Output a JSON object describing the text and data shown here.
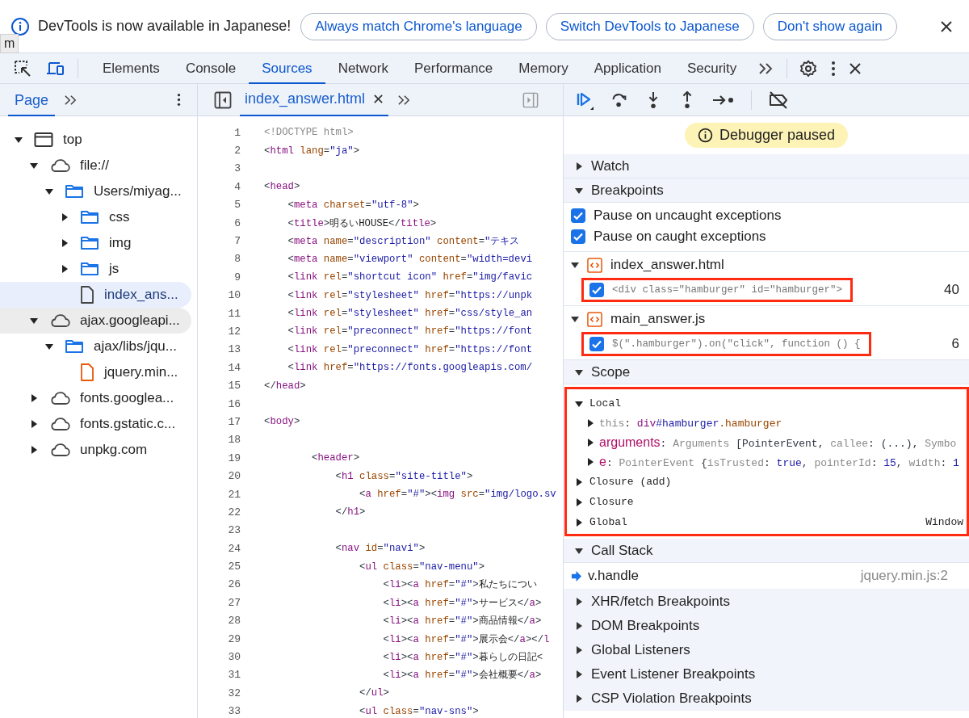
{
  "banner": {
    "message": "DevTools is now available in Japanese!",
    "buttons": [
      "Always match Chrome's language",
      "Switch DevTools to Japanese",
      "Don't show again"
    ]
  },
  "tooltip": "m",
  "tabs": [
    {
      "label": "Elements",
      "selected": false
    },
    {
      "label": "Console",
      "selected": false
    },
    {
      "label": "Sources",
      "selected": true
    },
    {
      "label": "Network",
      "selected": false
    },
    {
      "label": "Performance",
      "selected": false
    },
    {
      "label": "Memory",
      "selected": false
    },
    {
      "label": "Application",
      "selected": false
    },
    {
      "label": "Security",
      "selected": false
    }
  ],
  "navigator": {
    "tabs": [
      {
        "label": "Page",
        "selected": true
      }
    ],
    "tree": [
      {
        "label": "top",
        "kind": "frame",
        "expanded": true,
        "selected": false,
        "hovered": false,
        "children": [
          {
            "label": "file://",
            "kind": "domain",
            "expanded": true,
            "selected": false,
            "hovered": false,
            "children": [
              {
                "label": "Users/miyag...",
                "kind": "folder",
                "expanded": true,
                "selected": false,
                "hovered": false,
                "children": [
                  {
                    "label": "css",
                    "kind": "folder",
                    "expanded": false,
                    "selected": false,
                    "hovered": false
                  },
                  {
                    "label": "img",
                    "kind": "folder",
                    "expanded": false,
                    "selected": false,
                    "hovered": false
                  },
                  {
                    "label": "js",
                    "kind": "folder",
                    "expanded": false,
                    "selected": false,
                    "hovered": false
                  },
                  {
                    "label": "index_ans...",
                    "kind": "file",
                    "selected": true,
                    "hovered": false
                  }
                ]
              }
            ]
          },
          {
            "label": "ajax.googleapi...",
            "kind": "domain",
            "expanded": true,
            "selected": false,
            "hovered": true,
            "children": [
              {
                "label": "ajax/libs/jqu...",
                "kind": "folder",
                "expanded": true,
                "selected": false,
                "hovered": false,
                "children": [
                  {
                    "label": "jquery.min...",
                    "kind": "script",
                    "selected": false,
                    "hovered": false
                  }
                ]
              }
            ]
          },
          {
            "label": "fonts.googlea...",
            "kind": "domain",
            "expanded": false,
            "selected": false,
            "hovered": false
          },
          {
            "label": "fonts.gstatic.c...",
            "kind": "domain",
            "expanded": false,
            "selected": false,
            "hovered": false
          },
          {
            "label": "unpkg.com",
            "kind": "domain",
            "expanded": false,
            "selected": false,
            "hovered": false
          }
        ]
      }
    ]
  },
  "editor": {
    "tabs": [
      {
        "label": "index_answer.html",
        "selected": true
      }
    ],
    "lines": [
      {
        "n": "1",
        "code": [
          {
            "kind": "doc",
            "text": "<!DOCTYPE html>"
          }
        ]
      },
      {
        "n": "2",
        "code": [
          {
            "kind": "p",
            "text": "<"
          },
          {
            "kind": "tag",
            "text": "html"
          },
          {
            "kind": "attr",
            "text": " lang"
          },
          {
            "kind": "p",
            "text": "="
          },
          {
            "kind": "str",
            "text": "\"ja\""
          },
          {
            "kind": "p",
            "text": ">"
          }
        ]
      },
      {
        "n": "3"
      },
      {
        "n": "4",
        "code": [
          {
            "kind": "p",
            "text": "<"
          },
          {
            "kind": "tag",
            "text": "head"
          },
          {
            "kind": "p",
            "text": ">"
          }
        ]
      },
      {
        "n": "5",
        "code": [
          {
            "kind": "p",
            "text": "    <"
          },
          {
            "kind": "tag",
            "text": "meta"
          },
          {
            "kind": "attr",
            "text": " charset"
          },
          {
            "kind": "p",
            "text": "="
          },
          {
            "kind": "str",
            "text": "\"utf-8\""
          },
          {
            "kind": "p",
            "text": ">"
          }
        ]
      },
      {
        "n": "6",
        "code": [
          {
            "kind": "p",
            "text": "    <"
          },
          {
            "kind": "tag",
            "text": "title"
          },
          {
            "kind": "p",
            "text": ">"
          },
          {
            "kind": "text",
            "text": "明るいHOUSE"
          },
          {
            "kind": "p",
            "text": "</"
          },
          {
            "kind": "tag",
            "text": "title"
          },
          {
            "kind": "p",
            "text": ">"
          }
        ]
      },
      {
        "n": "7",
        "code": [
          {
            "kind": "p",
            "text": "    <"
          },
          {
            "kind": "tag",
            "text": "meta"
          },
          {
            "kind": "attr",
            "text": " name"
          },
          {
            "kind": "p",
            "text": "="
          },
          {
            "kind": "str",
            "text": "\"description\""
          },
          {
            "kind": "attr",
            "text": " content"
          },
          {
            "kind": "p",
            "text": "="
          },
          {
            "kind": "str",
            "text": "\"テキス"
          }
        ]
      },
      {
        "n": "8",
        "code": [
          {
            "kind": "p",
            "text": "    <"
          },
          {
            "kind": "tag",
            "text": "meta"
          },
          {
            "kind": "attr",
            "text": " name"
          },
          {
            "kind": "p",
            "text": "="
          },
          {
            "kind": "str",
            "text": "\"viewport\""
          },
          {
            "kind": "attr",
            "text": " content"
          },
          {
            "kind": "p",
            "text": "="
          },
          {
            "kind": "str",
            "text": "\"width=devi"
          }
        ]
      },
      {
        "n": "9",
        "code": [
          {
            "kind": "p",
            "text": "    <"
          },
          {
            "kind": "tag",
            "text": "link"
          },
          {
            "kind": "attr",
            "text": " rel"
          },
          {
            "kind": "p",
            "text": "="
          },
          {
            "kind": "str",
            "text": "\"shortcut icon\""
          },
          {
            "kind": "attr",
            "text": " href"
          },
          {
            "kind": "p",
            "text": "="
          },
          {
            "kind": "str",
            "text": "\"img/favic"
          }
        ]
      },
      {
        "n": "10",
        "code": [
          {
            "kind": "p",
            "text": "    <"
          },
          {
            "kind": "tag",
            "text": "link"
          },
          {
            "kind": "attr",
            "text": " rel"
          },
          {
            "kind": "p",
            "text": "="
          },
          {
            "kind": "str",
            "text": "\"stylesheet\""
          },
          {
            "kind": "attr",
            "text": " href"
          },
          {
            "kind": "p",
            "text": "="
          },
          {
            "kind": "str",
            "text": "\"https://unpk"
          }
        ]
      },
      {
        "n": "11",
        "code": [
          {
            "kind": "p",
            "text": "    <"
          },
          {
            "kind": "tag",
            "text": "link"
          },
          {
            "kind": "attr",
            "text": " rel"
          },
          {
            "kind": "p",
            "text": "="
          },
          {
            "kind": "str",
            "text": "\"stylesheet\""
          },
          {
            "kind": "attr",
            "text": " href"
          },
          {
            "kind": "p",
            "text": "="
          },
          {
            "kind": "str",
            "text": "\"css/style_an"
          }
        ]
      },
      {
        "n": "12",
        "code": [
          {
            "kind": "p",
            "text": "    <"
          },
          {
            "kind": "tag",
            "text": "link"
          },
          {
            "kind": "attr",
            "text": " rel"
          },
          {
            "kind": "p",
            "text": "="
          },
          {
            "kind": "str",
            "text": "\"preconnect\""
          },
          {
            "kind": "attr",
            "text": " href"
          },
          {
            "kind": "p",
            "text": "="
          },
          {
            "kind": "str",
            "text": "\"https://font"
          }
        ]
      },
      {
        "n": "13",
        "code": [
          {
            "kind": "p",
            "text": "    <"
          },
          {
            "kind": "tag",
            "text": "link"
          },
          {
            "kind": "attr",
            "text": " rel"
          },
          {
            "kind": "p",
            "text": "="
          },
          {
            "kind": "str",
            "text": "\"preconnect\""
          },
          {
            "kind": "attr",
            "text": " href"
          },
          {
            "kind": "p",
            "text": "="
          },
          {
            "kind": "str",
            "text": "\"https://font"
          }
        ]
      },
      {
        "n": "14",
        "code": [
          {
            "kind": "p",
            "text": "    <"
          },
          {
            "kind": "tag",
            "text": "link"
          },
          {
            "kind": "attr",
            "text": " href"
          },
          {
            "kind": "p",
            "text": "="
          },
          {
            "kind": "str",
            "text": "\"https://fonts.googleapis.com/"
          }
        ]
      },
      {
        "n": "15",
        "code": [
          {
            "kind": "p",
            "text": "</"
          },
          {
            "kind": "tag",
            "text": "head"
          },
          {
            "kind": "p",
            "text": ">"
          }
        ]
      },
      {
        "n": "16"
      },
      {
        "n": "17",
        "code": [
          {
            "kind": "p",
            "text": "<"
          },
          {
            "kind": "tag",
            "text": "body"
          },
          {
            "kind": "p",
            "text": ">"
          }
        ]
      },
      {
        "n": "18"
      },
      {
        "n": "19",
        "code": [
          {
            "kind": "p",
            "text": "        <"
          },
          {
            "kind": "tag",
            "text": "header"
          },
          {
            "kind": "p",
            "text": ">"
          }
        ]
      },
      {
        "n": "20",
        "code": [
          {
            "kind": "p",
            "text": "            <"
          },
          {
            "kind": "tag",
            "text": "h1"
          },
          {
            "kind": "attr",
            "text": " class"
          },
          {
            "kind": "p",
            "text": "="
          },
          {
            "kind": "str",
            "text": "\"site-title\""
          },
          {
            "kind": "p",
            "text": ">"
          }
        ]
      },
      {
        "n": "21",
        "code": [
          {
            "kind": "p",
            "text": "                <"
          },
          {
            "kind": "tag",
            "text": "a"
          },
          {
            "kind": "attr",
            "text": " href"
          },
          {
            "kind": "p",
            "text": "="
          },
          {
            "kind": "str",
            "text": "\"#\""
          },
          {
            "kind": "p",
            "text": "><"
          },
          {
            "kind": "tag",
            "text": "img"
          },
          {
            "kind": "attr",
            "text": " src"
          },
          {
            "kind": "p",
            "text": "="
          },
          {
            "kind": "str",
            "text": "\"img/logo.sv"
          }
        ]
      },
      {
        "n": "22",
        "code": [
          {
            "kind": "p",
            "text": "            </"
          },
          {
            "kind": "tag",
            "text": "h1"
          },
          {
            "kind": "p",
            "text": ">"
          }
        ]
      },
      {
        "n": "23"
      },
      {
        "n": "24",
        "code": [
          {
            "kind": "p",
            "text": "            <"
          },
          {
            "kind": "tag",
            "text": "nav"
          },
          {
            "kind": "attr",
            "text": " id"
          },
          {
            "kind": "p",
            "text": "="
          },
          {
            "kind": "str",
            "text": "\"navi\""
          },
          {
            "kind": "p",
            "text": ">"
          }
        ]
      },
      {
        "n": "25",
        "code": [
          {
            "kind": "p",
            "text": "                <"
          },
          {
            "kind": "tag",
            "text": "ul"
          },
          {
            "kind": "attr",
            "text": " class"
          },
          {
            "kind": "p",
            "text": "="
          },
          {
            "kind": "str",
            "text": "\"nav-menu\""
          },
          {
            "kind": "p",
            "text": ">"
          }
        ]
      },
      {
        "n": "26",
        "code": [
          {
            "kind": "p",
            "text": "                    <"
          },
          {
            "kind": "tag",
            "text": "li"
          },
          {
            "kind": "p",
            "text": "><"
          },
          {
            "kind": "tag",
            "text": "a"
          },
          {
            "kind": "attr",
            "text": " href"
          },
          {
            "kind": "p",
            "text": "="
          },
          {
            "kind": "str",
            "text": "\"#\""
          },
          {
            "kind": "p",
            "text": ">"
          },
          {
            "kind": "text",
            "text": "私たちについ"
          }
        ]
      },
      {
        "n": "27",
        "code": [
          {
            "kind": "p",
            "text": "                    <"
          },
          {
            "kind": "tag",
            "text": "li"
          },
          {
            "kind": "p",
            "text": "><"
          },
          {
            "kind": "tag",
            "text": "a"
          },
          {
            "kind": "attr",
            "text": " href"
          },
          {
            "kind": "p",
            "text": "="
          },
          {
            "kind": "str",
            "text": "\"#\""
          },
          {
            "kind": "p",
            "text": ">"
          },
          {
            "kind": "text",
            "text": "サービス"
          },
          {
            "kind": "p",
            "text": "</"
          },
          {
            "kind": "tag",
            "text": "a"
          },
          {
            "kind": "p",
            "text": ">"
          }
        ]
      },
      {
        "n": "28",
        "code": [
          {
            "kind": "p",
            "text": "                    <"
          },
          {
            "kind": "tag",
            "text": "li"
          },
          {
            "kind": "p",
            "text": "><"
          },
          {
            "kind": "tag",
            "text": "a"
          },
          {
            "kind": "attr",
            "text": " href"
          },
          {
            "kind": "p",
            "text": "="
          },
          {
            "kind": "str",
            "text": "\"#\""
          },
          {
            "kind": "p",
            "text": ">"
          },
          {
            "kind": "text",
            "text": "商品情報"
          },
          {
            "kind": "p",
            "text": "</"
          },
          {
            "kind": "tag",
            "text": "a"
          },
          {
            "kind": "p",
            "text": ">"
          }
        ]
      },
      {
        "n": "29",
        "code": [
          {
            "kind": "p",
            "text": "                    <"
          },
          {
            "kind": "tag",
            "text": "li"
          },
          {
            "kind": "p",
            "text": "><"
          },
          {
            "kind": "tag",
            "text": "a"
          },
          {
            "kind": "attr",
            "text": " href"
          },
          {
            "kind": "p",
            "text": "="
          },
          {
            "kind": "str",
            "text": "\"#\""
          },
          {
            "kind": "p",
            "text": ">"
          },
          {
            "kind": "text",
            "text": "展示会"
          },
          {
            "kind": "p",
            "text": "</"
          },
          {
            "kind": "tag",
            "text": "a"
          },
          {
            "kind": "p",
            "text": "></"
          },
          {
            "kind": "tag",
            "text": "l"
          }
        ]
      },
      {
        "n": "30",
        "code": [
          {
            "kind": "p",
            "text": "                    <"
          },
          {
            "kind": "tag",
            "text": "li"
          },
          {
            "kind": "p",
            "text": "><"
          },
          {
            "kind": "tag",
            "text": "a"
          },
          {
            "kind": "attr",
            "text": " href"
          },
          {
            "kind": "p",
            "text": "="
          },
          {
            "kind": "str",
            "text": "\"#\""
          },
          {
            "kind": "p",
            "text": ">"
          },
          {
            "kind": "text",
            "text": "暮らしの日記"
          },
          {
            "kind": "p",
            "text": "<"
          }
        ]
      },
      {
        "n": "31",
        "code": [
          {
            "kind": "p",
            "text": "                    <"
          },
          {
            "kind": "tag",
            "text": "li"
          },
          {
            "kind": "p",
            "text": "><"
          },
          {
            "kind": "tag",
            "text": "a"
          },
          {
            "kind": "attr",
            "text": " href"
          },
          {
            "kind": "p",
            "text": "="
          },
          {
            "kind": "str",
            "text": "\"#\""
          },
          {
            "kind": "p",
            "text": ">"
          },
          {
            "kind": "text",
            "text": "会社概要"
          },
          {
            "kind": "p",
            "text": "</"
          },
          {
            "kind": "tag",
            "text": "a"
          },
          {
            "kind": "p",
            "text": ">"
          }
        ]
      },
      {
        "n": "32",
        "code": [
          {
            "kind": "p",
            "text": "                </"
          },
          {
            "kind": "tag",
            "text": "ul"
          },
          {
            "kind": "p",
            "text": ">"
          }
        ]
      },
      {
        "n": "33",
        "code": [
          {
            "kind": "p",
            "text": "                <"
          },
          {
            "kind": "tag",
            "text": "ul"
          },
          {
            "kind": "attr",
            "text": " class"
          },
          {
            "kind": "p",
            "text": "="
          },
          {
            "kind": "str",
            "text": "\"nav-sns\""
          },
          {
            "kind": "p",
            "text": ">"
          }
        ]
      }
    ]
  },
  "debugger": {
    "status": "Debugger paused",
    "watch": {
      "title": "Watch",
      "expanded": false
    },
    "breakpoints": {
      "title": "Breakpoints",
      "expanded": true,
      "options": [
        {
          "label": "Pause on uncaught exceptions",
          "checked": true
        },
        {
          "label": "Pause on caught exceptions",
          "checked": true
        }
      ],
      "files": [
        {
          "name": "index_answer.html",
          "expanded": true,
          "items": [
            {
              "code": "<div class=\"hamburger\" id=\"hamburger\">",
              "line": "40",
              "checked": true,
              "outlined": true
            }
          ]
        },
        {
          "name": "main_answer.js",
          "expanded": true,
          "items": [
            {
              "code": "$(\".hamburger\").on(\"click\", function () {",
              "line": "6",
              "checked": true,
              "outlined": true
            }
          ]
        }
      ]
    },
    "scope": {
      "title": "Scope",
      "expanded": true,
      "outlined": true,
      "groups": [
        {
          "label": "Local",
          "expanded": true,
          "vars": [
            {
              "expanded": false,
              "tokens": [
                {
                  "kind": "dim",
                  "text": "this"
                },
                {
                  "kind": "p",
                  "text": ": "
                },
                {
                  "kind": "tag",
                  "text": "div"
                },
                {
                  "kind": "str",
                  "text": "#hamburger"
                },
                {
                  "kind": "attr",
                  "text": ".hamburger"
                }
              ]
            },
            {
              "expanded": false,
              "tokens": [
                {
                  "kind": "var",
                  "text": "arguments"
                },
                {
                  "kind": "p",
                  "text": ": "
                },
                {
                  "kind": "dim",
                  "text": "Arguments "
                },
                {
                  "kind": "p",
                  "text": "[PointerEvent, "
                },
                {
                  "kind": "dim",
                  "text": "callee"
                },
                {
                  "kind": "p",
                  "text": ": (...), "
                },
                {
                  "kind": "dim",
                  "text": "Symbo"
                }
              ]
            },
            {
              "expanded": false,
              "tokens": [
                {
                  "kind": "var",
                  "text": "e"
                },
                {
                  "kind": "p",
                  "text": ": "
                },
                {
                  "kind": "dim",
                  "text": "PointerEvent "
                },
                {
                  "kind": "p",
                  "text": "{"
                },
                {
                  "kind": "dim",
                  "text": "isTrusted"
                },
                {
                  "kind": "p",
                  "text": ": "
                },
                {
                  "kind": "str",
                  "text": "true"
                },
                {
                  "kind": "p",
                  "text": ", "
                },
                {
                  "kind": "dim",
                  "text": "pointerId"
                },
                {
                  "kind": "p",
                  "text": ": "
                },
                {
                  "kind": "str",
                  "text": "15"
                },
                {
                  "kind": "p",
                  "text": ", "
                },
                {
                  "kind": "dim",
                  "text": "width"
                },
                {
                  "kind": "p",
                  "text": ": "
                },
                {
                  "kind": "str",
                  "text": "1"
                }
              ]
            }
          ]
        },
        {
          "label": "Closure (add)",
          "expanded": false
        },
        {
          "label": "Closure",
          "expanded": false
        },
        {
          "label": "Global",
          "expanded": false,
          "value": "Window"
        }
      ]
    },
    "call_stack": {
      "title": "Call Stack",
      "expanded": true,
      "frames": [
        {
          "name": "v.handle",
          "location": "jquery.min.js:2",
          "selected": true
        }
      ]
    },
    "more_sections": [
      {
        "title": "XHR/fetch Breakpoints",
        "expanded": false
      },
      {
        "title": "DOM Breakpoints",
        "expanded": false
      },
      {
        "title": "Global Listeners",
        "expanded": false
      },
      {
        "title": "Event Listener Breakpoints",
        "expanded": false
      },
      {
        "title": "CSP Violation Breakpoints",
        "expanded": false
      }
    ]
  }
}
